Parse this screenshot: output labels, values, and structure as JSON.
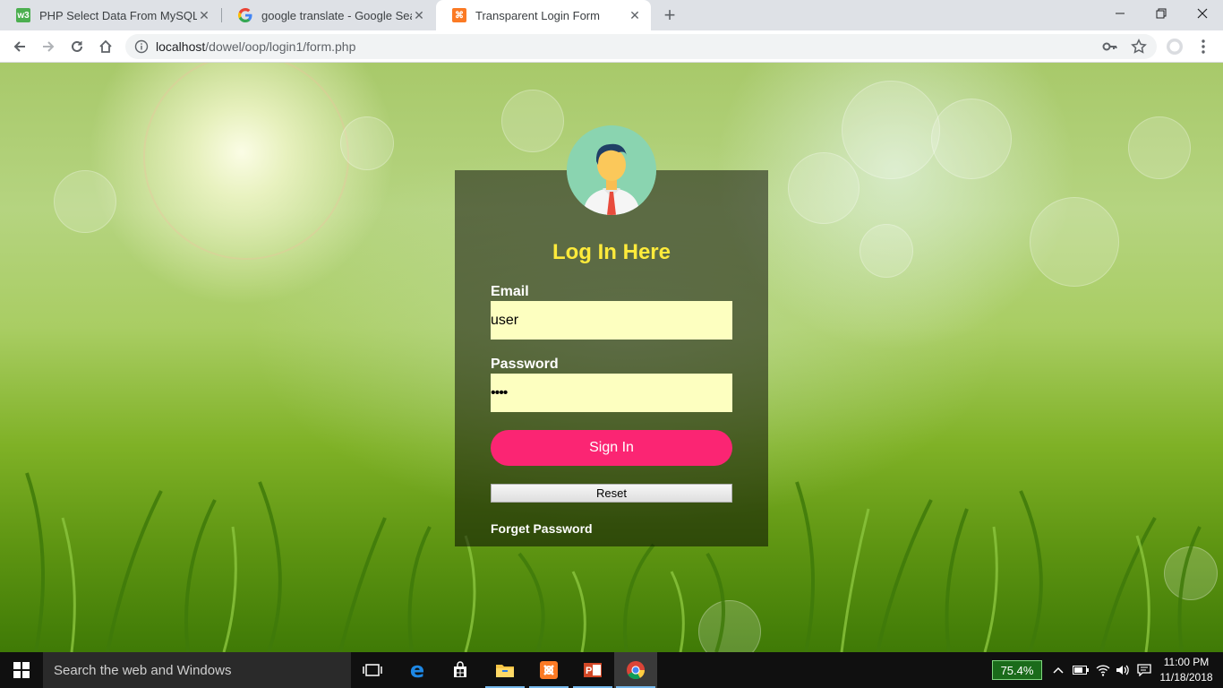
{
  "browser": {
    "tabs": [
      {
        "title": "PHP Select Data From MySQL",
        "favicon": "w3schools-icon"
      },
      {
        "title": "google translate - Google Search",
        "favicon": "google-icon"
      },
      {
        "title": "Transparent Login Form",
        "favicon": "xampp-icon",
        "active": true
      }
    ],
    "url_host": "localhost",
    "url_path": "/dowel/oop/login1/form.php"
  },
  "login": {
    "heading": "Log In Here",
    "email_label": "Email",
    "email_value": "user",
    "password_label": "Password",
    "password_value": "••••",
    "signin_label": "Sign In",
    "reset_label": "Reset",
    "forget_label": "Forget Password"
  },
  "taskbar": {
    "search_placeholder": "Search the web and Windows",
    "battery_percent": "75.4%",
    "time": "11:00 PM",
    "date": "11/18/2018"
  },
  "colors": {
    "heading": "#ffeb3b",
    "input_bg": "#fdffc0",
    "signin_bg": "#fb2573"
  }
}
